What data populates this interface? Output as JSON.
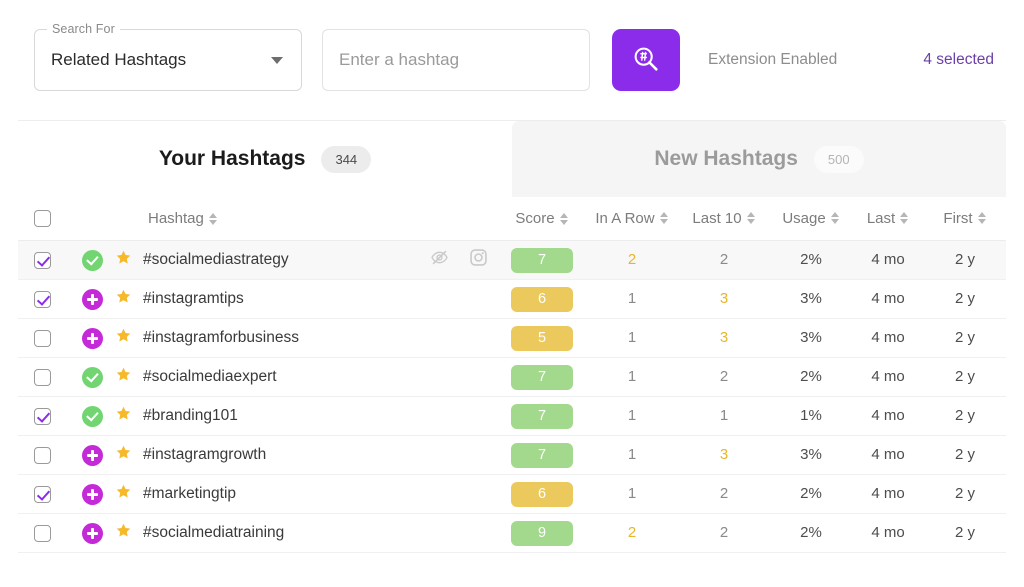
{
  "toolbar": {
    "select_label": "Search For",
    "select_value": "Related Hashtags",
    "input_placeholder": "Enter a hashtag",
    "search_icon": "hashtag-magnifier-icon",
    "extension_status": "Extension Enabled",
    "selected_count": "4 selected",
    "accent_color": "#8c2ceb",
    "selected_color": "#6b3fa8"
  },
  "tabs": [
    {
      "label": "Your Hashtags",
      "badge": "344",
      "active": true
    },
    {
      "label": "New Hashtags",
      "badge": "500",
      "active": false
    }
  ],
  "table": {
    "columns": [
      {
        "key": "hashtag",
        "label": "Hashtag"
      },
      {
        "key": "score",
        "label": "Score"
      },
      {
        "key": "in_a_row",
        "label": "In A Row"
      },
      {
        "key": "last_10",
        "label": "Last 10"
      },
      {
        "key": "usage",
        "label": "Usage"
      },
      {
        "key": "last",
        "label": "Last"
      },
      {
        "key": "first",
        "label": "First"
      }
    ],
    "header_checkbox_checked": false,
    "hover_row_icons": [
      "eye-slash-icon",
      "instagram-camera-icon"
    ],
    "score_colors": {
      "green": "#a2d98c",
      "amber": "#ecc95d"
    },
    "rows": [
      {
        "checked": true,
        "status": "check",
        "starred": true,
        "hashtag": "#socialmediastrategy",
        "score": "7",
        "score_color": "green",
        "in_a_row": "2",
        "in_a_row_hi": true,
        "last_10": "2",
        "last_10_hi": false,
        "usage": "2%",
        "last": "4 mo",
        "first": "2 y",
        "hovered": true
      },
      {
        "checked": true,
        "status": "plus",
        "starred": true,
        "hashtag": "#instagramtips",
        "score": "6",
        "score_color": "amber",
        "in_a_row": "1",
        "in_a_row_hi": false,
        "last_10": "3",
        "last_10_hi": true,
        "usage": "3%",
        "last": "4 mo",
        "first": "2 y",
        "hovered": false
      },
      {
        "checked": false,
        "status": "plus",
        "starred": true,
        "hashtag": "#instagramforbusiness",
        "score": "5",
        "score_color": "amber",
        "in_a_row": "1",
        "in_a_row_hi": false,
        "last_10": "3",
        "last_10_hi": true,
        "usage": "3%",
        "last": "4 mo",
        "first": "2 y",
        "hovered": false
      },
      {
        "checked": false,
        "status": "check",
        "starred": true,
        "hashtag": "#socialmediaexpert",
        "score": "7",
        "score_color": "green",
        "in_a_row": "1",
        "in_a_row_hi": false,
        "last_10": "2",
        "last_10_hi": false,
        "usage": "2%",
        "last": "4 mo",
        "first": "2 y",
        "hovered": false
      },
      {
        "checked": true,
        "status": "check",
        "starred": true,
        "hashtag": "#branding101",
        "score": "7",
        "score_color": "green",
        "in_a_row": "1",
        "in_a_row_hi": false,
        "last_10": "1",
        "last_10_hi": false,
        "usage": "1%",
        "last": "4 mo",
        "first": "2 y",
        "hovered": false
      },
      {
        "checked": false,
        "status": "plus",
        "starred": true,
        "hashtag": "#instagramgrowth",
        "score": "7",
        "score_color": "green",
        "in_a_row": "1",
        "in_a_row_hi": false,
        "last_10": "3",
        "last_10_hi": true,
        "usage": "3%",
        "last": "4 mo",
        "first": "2 y",
        "hovered": false
      },
      {
        "checked": true,
        "status": "plus",
        "starred": true,
        "hashtag": "#marketingtip",
        "score": "6",
        "score_color": "amber",
        "in_a_row": "1",
        "in_a_row_hi": false,
        "last_10": "2",
        "last_10_hi": false,
        "usage": "2%",
        "last": "4 mo",
        "first": "2 y",
        "hovered": false
      },
      {
        "checked": false,
        "status": "plus",
        "starred": true,
        "hashtag": "#socialmediatraining",
        "score": "9",
        "score_color": "green",
        "in_a_row": "2",
        "in_a_row_hi": true,
        "last_10": "2",
        "last_10_hi": false,
        "usage": "2%",
        "last": "4 mo",
        "first": "2 y",
        "hovered": false
      }
    ]
  }
}
